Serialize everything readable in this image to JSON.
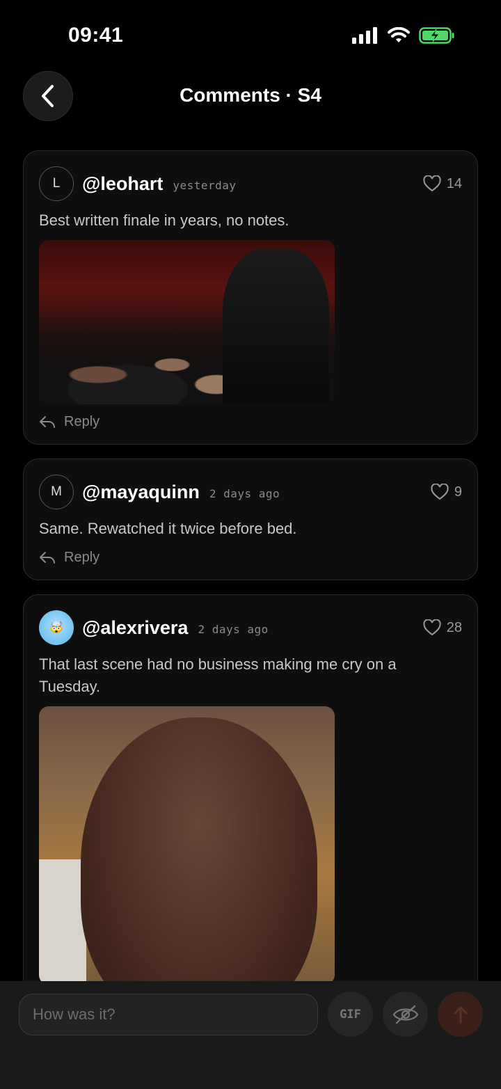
{
  "status_bar": {
    "time": "09:41"
  },
  "header": {
    "title": "Comments · S4"
  },
  "comments": [
    {
      "avatar_letter": "L",
      "username": "@leohart",
      "timestamp": "yesterday",
      "likes": "14",
      "text": "Best written finale in years, no notes.",
      "media": "gif-audience-applause",
      "reply_label": "Reply"
    },
    {
      "avatar_letter": "M",
      "username": "@mayaquinn",
      "timestamp": "2 days ago",
      "likes": "9",
      "text": "Same. Rewatched it twice before bed.",
      "reply_label": "Reply"
    },
    {
      "avatar_emoji": "🤯",
      "username": "@alexrivera",
      "timestamp": "2 days ago",
      "likes": "28",
      "text": "That last scene had no business making me cry on a Tuesday.",
      "media": "gif-crying-man"
    }
  ],
  "composer": {
    "placeholder": "How was it?",
    "gif_label": "GIF"
  },
  "colors": {
    "background": "#000000",
    "card": "#0e0e0e",
    "send_button": "#3a2018",
    "battery": "#4cd964"
  }
}
